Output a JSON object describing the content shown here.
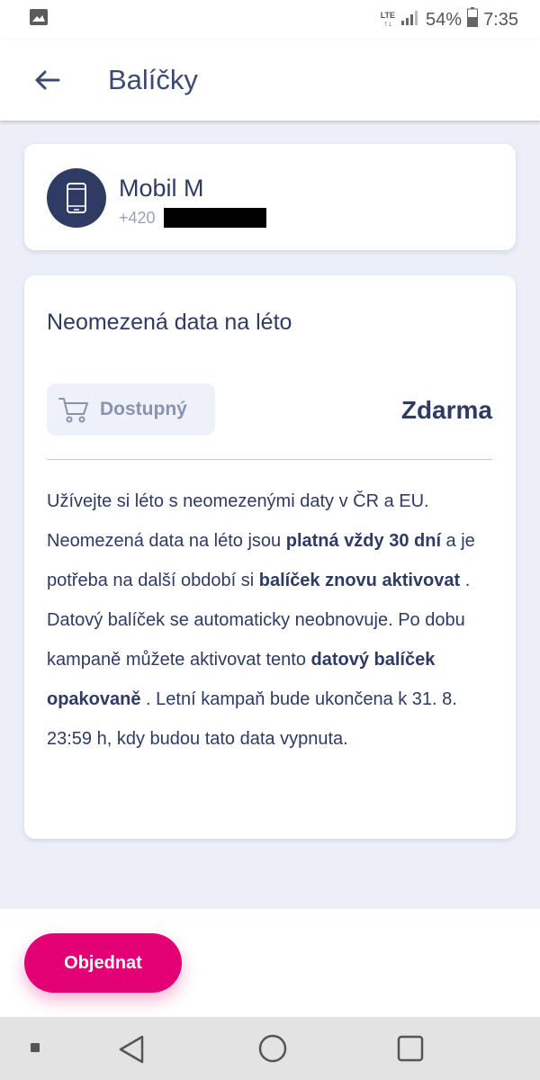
{
  "status_bar": {
    "network_top": "LTE",
    "network_bottom": "↑↓",
    "battery": "54%",
    "time": "7:35"
  },
  "app_bar": {
    "title": "Balíčky"
  },
  "plan_card": {
    "name": "Mobil M",
    "number_prefix": "+420"
  },
  "offer": {
    "title": "Neomezená data na léto",
    "status": "Dostupný",
    "price": "Zdarma",
    "desc": {
      "t1": "Užívejte si léto s neomezenými daty v ČR a EU. Neomezená data na léto jsou ",
      "b1": "platná vždy 30 dní",
      "t2": " a je potřeba na další období si ",
      "b2": "balíček znovu aktivovat",
      "t3": " . Datový balíček se automaticky neobnovuje. Po dobu kampaně můžete aktivovat tento ",
      "b3": "datový balíček opakovaně",
      "t4": " . Letní kampaň bude ukončena k 31. 8. 23:59 h, kdy budou tato data vypnuta."
    }
  },
  "order_button": {
    "label": "Objednat"
  },
  "colors": {
    "accent": "#e20074",
    "primary_text": "#2f3b63",
    "background": "#eceff8"
  },
  "icons": [
    "image-icon",
    "signal-icon",
    "battery-icon",
    "back-arrow-icon",
    "phone-icon",
    "cart-icon",
    "nav-recent-icon",
    "nav-back-icon",
    "nav-home-icon",
    "nav-overview-icon"
  ]
}
